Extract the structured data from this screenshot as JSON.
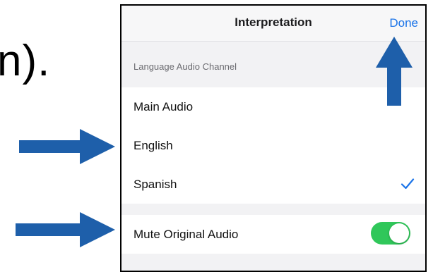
{
  "slide": {
    "fragment_text": "n)."
  },
  "panel": {
    "title": "Interpretation",
    "done_label": "Done",
    "section_header": "Language Audio Channel",
    "options": [
      {
        "label": "Main Audio",
        "selected": false
      },
      {
        "label": "English",
        "selected": false
      },
      {
        "label": "Spanish",
        "selected": true
      }
    ],
    "mute": {
      "label": "Mute Original Audio",
      "enabled": true
    }
  },
  "colors": {
    "accent": "#1a73e8",
    "toggle_on": "#30c75a",
    "arrow": "#1e5faa"
  },
  "icons": {
    "checkmark": "checkmark-icon",
    "arrows": [
      "arrow-up-icon",
      "arrow-right-icon",
      "arrow-right-icon"
    ]
  }
}
